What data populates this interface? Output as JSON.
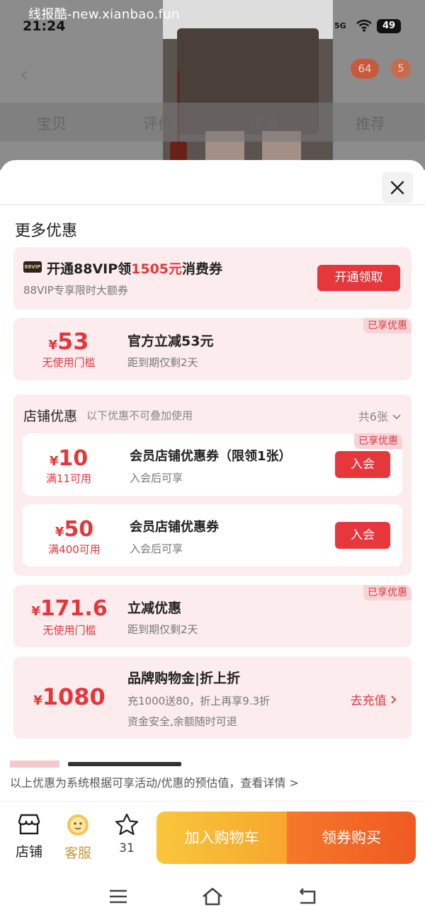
{
  "watermark": "线报酷-new.xianbao.fun",
  "status": {
    "time": "21:24",
    "signal": "5G",
    "battery": "49"
  },
  "background": {
    "cart_count": "64",
    "more_count": "5",
    "tabs": [
      "宝贝",
      "评价",
      "详情",
      "推荐"
    ]
  },
  "sheet": {
    "title": "更多优惠",
    "vip": {
      "badge": "88VIP",
      "title_prefix": "开通88VIP领",
      "title_amount": "1505元",
      "title_suffix": "消费券",
      "subtitle": "88VIP专享限时大额券",
      "button": "开通领取"
    },
    "official": {
      "tag": "已享优惠",
      "currency": "¥",
      "amount": "53",
      "threshold": "无使用门槛",
      "title": "官方立减53元",
      "subtitle": "距到期仅剩2天"
    },
    "shop": {
      "title": "店铺优惠",
      "note": "以下优惠不可叠加使用",
      "count": "共6张",
      "coupons": [
        {
          "tag": "已享优惠",
          "currency": "¥",
          "amount": "10",
          "threshold": "满11可用",
          "title": "会员店铺优惠券（限领1张）",
          "subtitle": "入会后可享",
          "button": "入会"
        },
        {
          "currency": "¥",
          "amount": "50",
          "threshold": "满400可用",
          "title": "会员店铺优惠券",
          "subtitle": "入会后可享",
          "button": "入会"
        }
      ]
    },
    "lijian": {
      "tag": "已享优惠",
      "currency": "¥",
      "amount": "171.6",
      "threshold": "无使用门槛",
      "title": "立减优惠",
      "subtitle": "距到期仅剩2天"
    },
    "brand": {
      "currency": "¥",
      "amount": "1080",
      "title": "品牌购物金|折上折",
      "line1": "充1000送80，折上再享9.3折",
      "line2": "资金安全,余额随时可退",
      "action": "去充值"
    },
    "disclaimer": "以上优惠为系统根据可享活动/优惠的预估值，查看详情 >"
  },
  "action_bar": {
    "shop": "店铺",
    "service": "客服",
    "favorites": "31",
    "add_cart": "加入购物车",
    "buy": "领券购买"
  },
  "colors": {
    "accent_red": "#e5373c",
    "card_bg": "#fcecee",
    "cart_yellow": "#f9c63d",
    "buy_orange": "#ef5a22",
    "service_gold": "#c9973a"
  }
}
